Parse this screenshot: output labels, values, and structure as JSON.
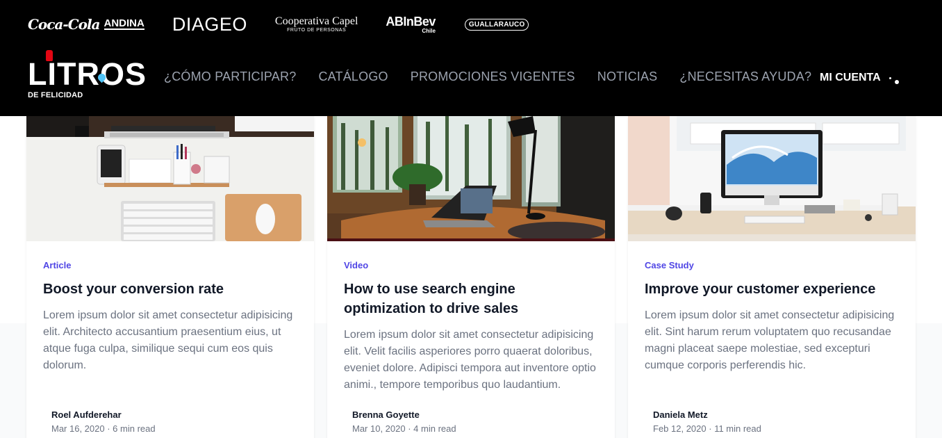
{
  "sponsors": {
    "coke": "Coca-Cola",
    "andina": "ANDINA",
    "diageo": "DIAGEO",
    "capel_main": "Cooperativa Capel",
    "capel_sub": "FRUTO DE PERSONAS",
    "abinbev_main": "ABInBev",
    "abinbev_sub": "Chile",
    "guallarauco": "GUALLARAUCO"
  },
  "brand": {
    "name": "LITROS",
    "tagline": "DE FELICIDAD"
  },
  "nav": {
    "items": [
      "¿CÓMO PARTICIPAR?",
      "CATÁLOGO",
      "PROMOCIONES VIGENTES",
      "NOTICIAS",
      "¿NECESITAS AYUDA?"
    ],
    "account_label": "MI CUENTA"
  },
  "cards": [
    {
      "category": "Article",
      "title": "Boost your conversion rate",
      "description": "Lorem ipsum dolor sit amet consectetur adipisicing elit. Architecto accusantium praesentium eius, ut atque fuga culpa, similique sequi cum eos quis dolorum.",
      "author": "Roel Aufderehar",
      "date": "Mar 16, 2020",
      "read_time": "6 min read"
    },
    {
      "category": "Video",
      "title": "How to use search engine optimization to drive sales",
      "description": "Lorem ipsum dolor sit amet consectetur adipisicing elit. Velit facilis asperiores porro quaerat doloribus, eveniet dolore. Adipisci tempora aut inventore optio animi., tempore temporibus quo laudantium.",
      "author": "Brenna Goyette",
      "date": "Mar 10, 2020",
      "read_time": "4 min read"
    },
    {
      "category": "Case Study",
      "title": "Improve your customer experience",
      "description": "Lorem ipsum dolor sit amet consectetur adipisicing elit. Sint harum rerum voluptatem quo recusandae magni placeat saepe molestiae, sed excepturi cumque corporis perferendis hic.",
      "author": "Daniela Metz",
      "date": "Feb 12, 2020",
      "read_time": "11 min read"
    }
  ],
  "colors": {
    "header_bg": "#000000",
    "nav_text": "#9ca3af",
    "category_accent": "#5046e5",
    "brand_red": "#e30613"
  }
}
